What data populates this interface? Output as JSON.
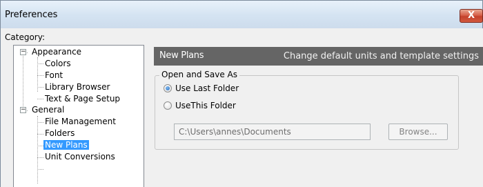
{
  "window": {
    "title": "Preferences",
    "close_label": "X"
  },
  "category": {
    "label": "Category:"
  },
  "tree": {
    "nodes": [
      {
        "label": "Appearance",
        "expanded": true,
        "expander": "−"
      },
      {
        "label": "Colors"
      },
      {
        "label": "Font"
      },
      {
        "label": "Library Browser"
      },
      {
        "label": "Text & Page Setup"
      },
      {
        "label": "General",
        "expanded": true,
        "expander": "−"
      },
      {
        "label": "File Management"
      },
      {
        "label": "Folders"
      },
      {
        "label": "New Plans",
        "selected": true
      },
      {
        "label": "Unit Conversions"
      }
    ]
  },
  "panel": {
    "title": "New Plans",
    "description": "Change default units and template settings",
    "header_color": "#656565"
  },
  "group": {
    "legend": "Open and Save As",
    "options": [
      {
        "label": "Use Last Folder",
        "checked": true
      },
      {
        "label": "UseThis Folder",
        "checked": false
      }
    ],
    "folder_path": "C:\\Users\\annes\\Documents",
    "browse_label": "Browse..."
  },
  "colors": {
    "selection": "#3399ff",
    "close_button": "#c4412c"
  }
}
